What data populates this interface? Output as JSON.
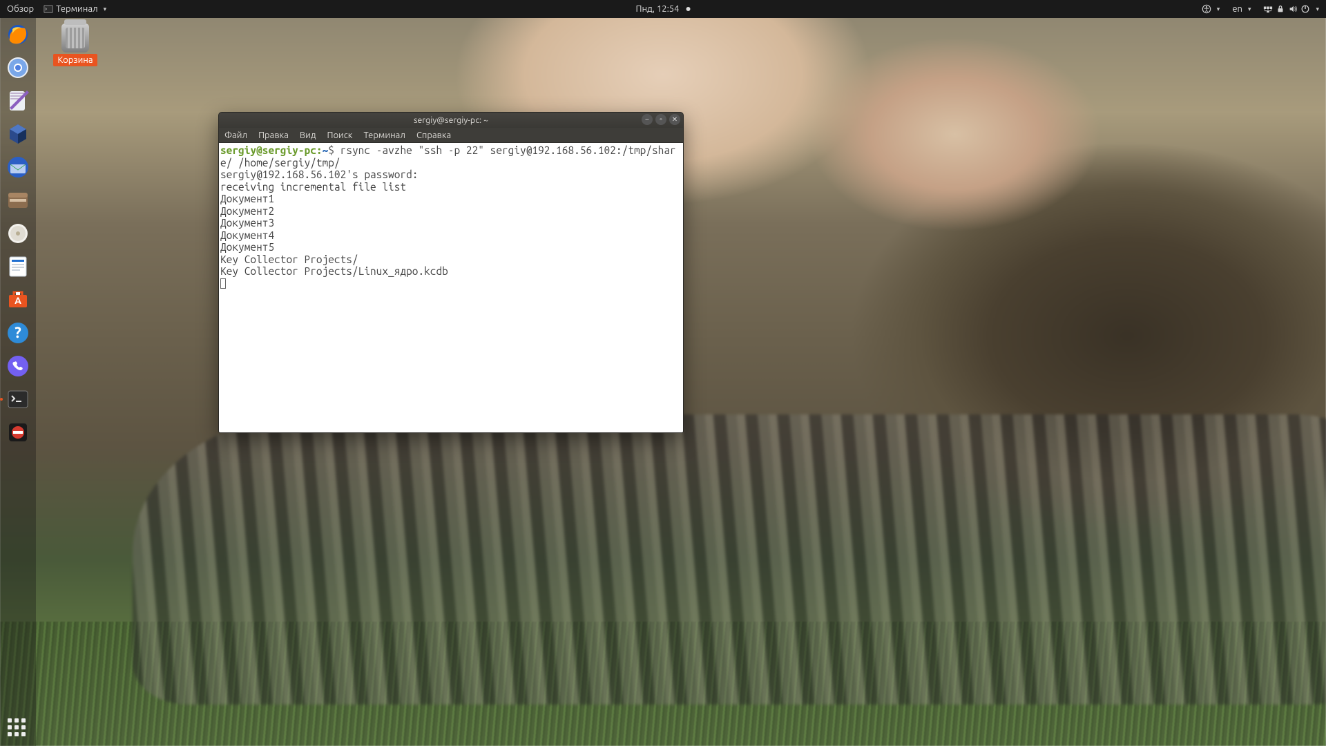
{
  "topbar": {
    "activities": "Обзор",
    "app_indicator": "Терминал",
    "clock": "Пнд, 12:54",
    "lang": "en"
  },
  "desktop": {
    "trash_label": "Корзина"
  },
  "dock": {
    "items": [
      "firefox",
      "chromium",
      "gedit",
      "virtualbox",
      "thunderbird",
      "files",
      "rhythmbox",
      "writer",
      "software",
      "help",
      "viber",
      "terminal",
      "blocked"
    ]
  },
  "window": {
    "title": "sergiy@sergiy-pc: ~",
    "menu": {
      "file": "Файл",
      "edit": "Правка",
      "view": "Вид",
      "search": "Поиск",
      "terminal": "Терминал",
      "help": "Справка"
    }
  },
  "terminal": {
    "prompt_user": "sergiy@sergiy-pc",
    "prompt_sep": ":",
    "prompt_path": "~",
    "prompt_dollar": "$ ",
    "command": "rsync -avzhe \"ssh -p 22\" sergiy@192.168.56.102:/tmp/share/ /home/sergiy/tmp/",
    "lines": [
      "sergiy@192.168.56.102's password:",
      "receiving incremental file list",
      "Документ1",
      "Документ2",
      "Документ3",
      "Документ4",
      "Документ5",
      "Key Collector Projects/",
      "Key Collector Projects/Linux_ядро.kcdb"
    ]
  }
}
